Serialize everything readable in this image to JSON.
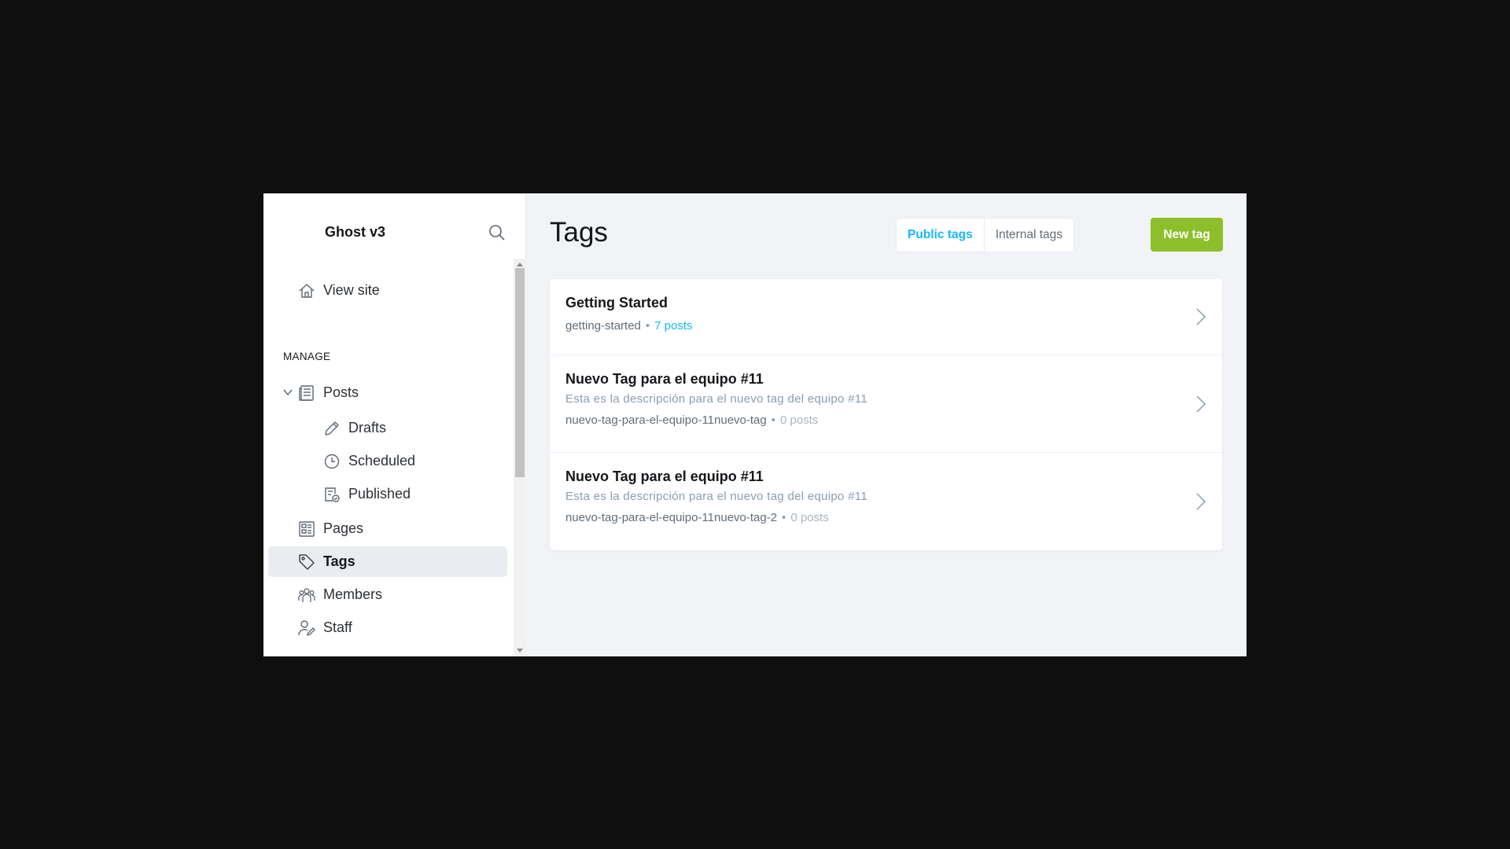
{
  "sidebar": {
    "brand": "Ghost v3",
    "view_site": "View site",
    "section_manage": "MANAGE",
    "items": {
      "posts": "Posts",
      "drafts": "Drafts",
      "scheduled": "Scheduled",
      "published": "Published",
      "pages": "Pages",
      "tags": "Tags",
      "members": "Members",
      "staff": "Staff"
    },
    "active_item": "tags"
  },
  "main": {
    "title": "Tags",
    "filters": {
      "public_label": "Public tags",
      "internal_label": "Internal tags",
      "selected": "Public tags"
    },
    "new_tag_label": "New tag",
    "tags": [
      {
        "name": "Getting Started",
        "description": "",
        "slug": "getting-started",
        "count": "7 posts"
      },
      {
        "name": "Nuevo Tag para el equipo #11",
        "description": "Esta es la descripción para el nuevo tag del equipo #11",
        "slug": "nuevo-tag-para-el-equipo-11nuevo-tag",
        "count": "0 posts"
      },
      {
        "name": "Nuevo Tag para el equipo #11",
        "description": "Esta es la descripción para el nuevo tag del equipo #11",
        "slug": "nuevo-tag-para-el-equipo-11nuevo-tag-2",
        "count": "0 posts"
      }
    ]
  },
  "colors": {
    "accent_blue": "#14b8ff",
    "new_tag_green": "#8cbf2a",
    "active_nav_bg": "#e9edf2",
    "main_bg": "#f1f3f6"
  }
}
